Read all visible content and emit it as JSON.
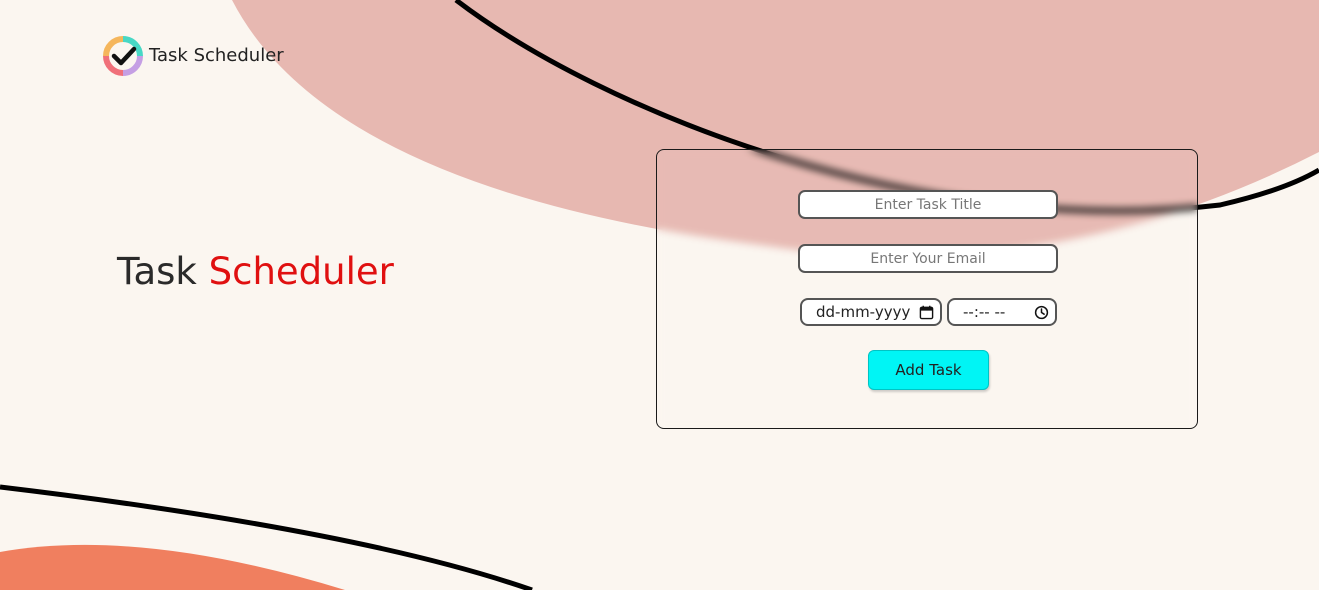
{
  "app": {
    "name": "Task Scheduler",
    "logo_icon": "check-circle-icon"
  },
  "hero": {
    "title_part1": "Task",
    "title_part2": "Scheduler"
  },
  "form": {
    "title_placeholder": "Enter Task Title",
    "email_placeholder": "Enter Your Email",
    "date_placeholder": "dd-mm-yyyy",
    "date_icon": "calendar-icon",
    "time_placeholder": "--:-- --",
    "time_icon": "clock-icon",
    "submit_label": "Add Task"
  },
  "colors": {
    "background": "#fbf6f0",
    "blob_top": "#e7b8b1",
    "blob_bottom": "#f07f5f",
    "accent_text": "#e01010",
    "button": "#00f5f5"
  }
}
